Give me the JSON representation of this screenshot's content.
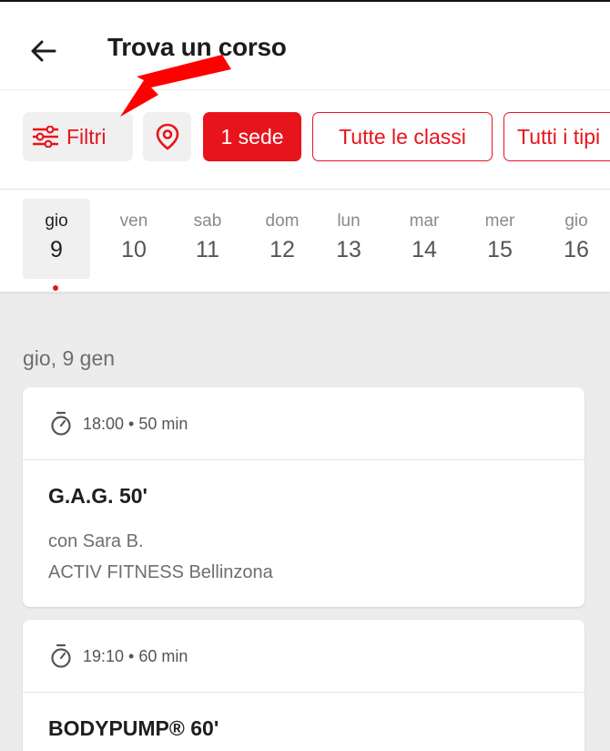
{
  "header": {
    "title": "Trova un corso",
    "back_icon": "arrow-left-icon"
  },
  "filters": {
    "filter_label": "Filtri",
    "location_icon": "map-pin-icon",
    "venue_label": "1 sede",
    "classes_label": "Tutte le classi",
    "types_label": "Tutti i tipi"
  },
  "colors": {
    "accent": "#e8141c",
    "background": "#ececec"
  },
  "days": [
    {
      "dow": "gio",
      "num": "9",
      "selected": true
    },
    {
      "dow": "ven",
      "num": "10"
    },
    {
      "dow": "sab",
      "num": "11"
    },
    {
      "dow": "dom",
      "num": "12"
    },
    {
      "dow": "lun",
      "num": "13"
    },
    {
      "dow": "mar",
      "num": "14"
    },
    {
      "dow": "mer",
      "num": "15"
    },
    {
      "dow": "gio",
      "num": "16"
    }
  ],
  "section": {
    "date_label": "gio, 9 gen"
  },
  "classes": [
    {
      "time": "18:00 • 50 min",
      "name": "G.A.G. 50'",
      "instructor": "con Sara B.",
      "location": "ACTIV FITNESS Bellinzona"
    },
    {
      "time": "19:10 • 60 min",
      "name": "BODYPUMP® 60'"
    }
  ]
}
